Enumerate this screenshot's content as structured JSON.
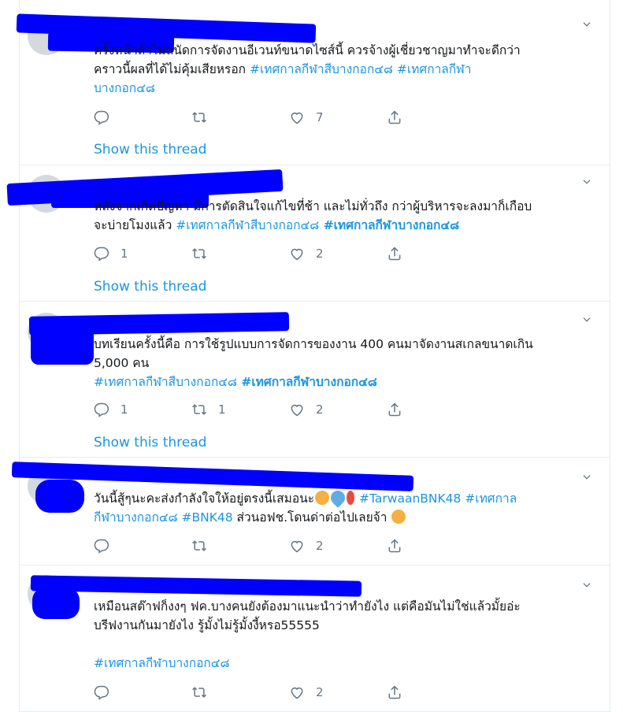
{
  "colors": {
    "link": "#1b95e0",
    "muted": "#657786",
    "border": "#e6ecf0",
    "redaction": "#0000ff"
  },
  "tweets": [
    {
      "line1": "ครั้งหน้าถ้าไม่ถนัดการจัดงานอีเวนท์ขนาดไซส์นี้ ควรจ้างผู้เชี่ยวชาญมาทำจะดีกว่า",
      "line2_text": "คราวนี้ผลที่ได้ไม่คุ้มเสียหรอก ",
      "line2_hash": "#เทศกาลกีฬาสีบางกอก๔๘",
      "line2_hash2": " #เทศกาลกีฬา",
      "line3_hash": "บางกอก๔๘",
      "reply_count": "",
      "retweet_count": "",
      "like_count": "7",
      "show_thread": "Show this thread"
    },
    {
      "line1": "หลังจากเกิดปัญหา มีการตัดสินใจแก้ไขที่ช้า และไม่ทั่วถึง กว่าผู้บริหารจะลงมาก็เกือบ",
      "line2_text": "จะบ่ายโมงแล้ว ",
      "line2_hash": "#เทศกาลกีฬาสีบางกอก๔๘",
      "line2_hash2": " #เทศกาลกีฬาบางกอก๔๘",
      "reply_count": "1",
      "retweet_count": "",
      "like_count": "2",
      "show_thread": "Show this thread"
    },
    {
      "line1": "บทเรียนครั้งนี้คือ การใช้รูปแบบการจัดการของงาน 400 คนมาจัดงานสเกลขนาดเกิน",
      "line2_text": "5,000 คน",
      "line3_hash": "#เทศกาลกีฬาสีบางกอก๔๘",
      "line3_hash2": " #เทศกาลกีฬาบางกอก๔๘",
      "reply_count": "1",
      "retweet_count": "1",
      "like_count": "2",
      "show_thread": "Show this thread"
    },
    {
      "line1_text": "วันนี้สู้ๆนะคะส่งกำลังใจให้อยู่ตรงนี้เสมอนะ",
      "line1_hash": " #TarwaanBNK48 #เทศกาล",
      "line2_hash": "กีฬาบางกอก๔๘ #BNK48",
      "line2_text": " ส่วนอฟช.โดนด่าต่อไปเลยจ้า ",
      "reply_count": "",
      "retweet_count": "",
      "like_count": "2"
    },
    {
      "line1": "เหมือนสต๊าฟก็งงๆ ฟค.บางคนยังต้องมาแนะนำว่าทำยังไง แต่คือมันไม่ใช่แล้วมั้ยอ่ะ",
      "line2": "บรีฟงานกันมายังไง รู้มั้งไม่รู้มั้งงี้หรอ55555",
      "line3_hash": "#เทศกาลกีฬาบางกอก๔๘",
      "reply_count": "",
      "retweet_count": "",
      "like_count": "2"
    }
  ]
}
